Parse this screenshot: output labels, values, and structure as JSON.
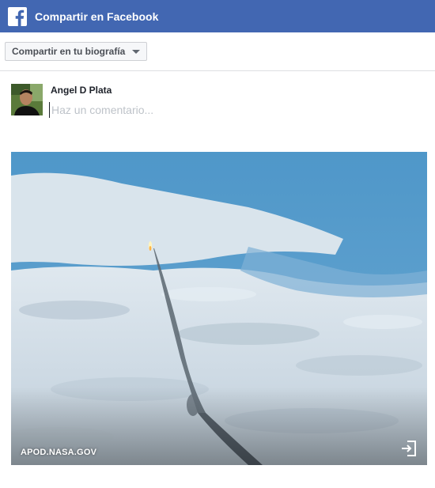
{
  "dialog": {
    "title": "Compartir en Facebook",
    "logo_icon": "facebook-icon",
    "header_color": "#4267b2"
  },
  "share": {
    "selected_option": "Compartir en tu biografía",
    "icon": "chevron-down-icon"
  },
  "composer": {
    "user_name": "Angel D Plata",
    "comment_placeholder": "Haz un comentario...",
    "comment_value": ""
  },
  "link_preview": {
    "domain": "APOD.NASA.GOV",
    "open_icon": "open-external-icon",
    "image_subject": "rocket-launch-over-clouds"
  }
}
